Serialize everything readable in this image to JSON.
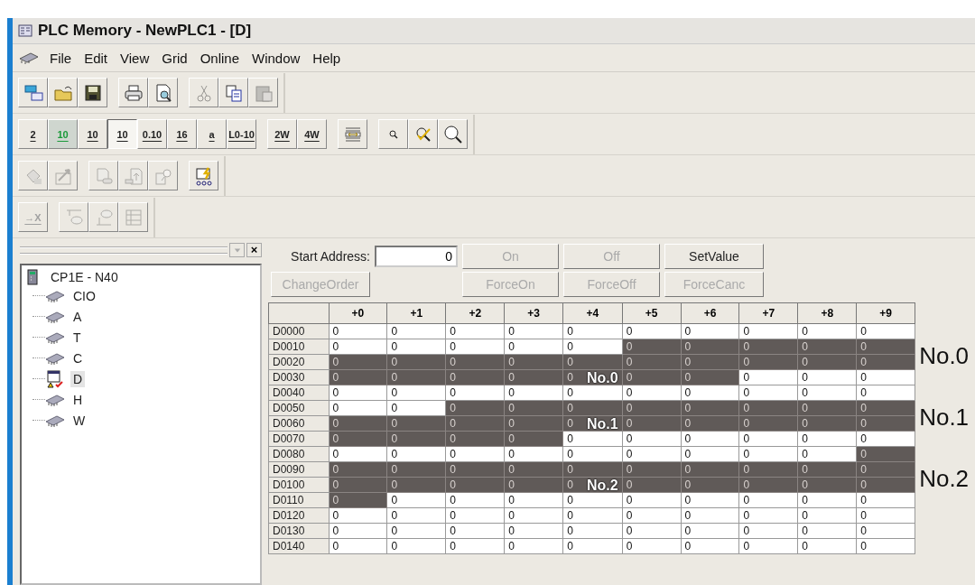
{
  "window": {
    "title": "PLC Memory - NewPLC1 - [D]"
  },
  "menu": [
    "File",
    "Edit",
    "View",
    "Grid",
    "Online",
    "Window",
    "Help"
  ],
  "toolbars": [
    [
      [
        {
          "kind": "windows",
          "disabled": false
        },
        {
          "kind": "folder",
          "disabled": false
        },
        {
          "kind": "floppy",
          "disabled": false
        }
      ],
      [
        {
          "kind": "printer",
          "disabled": false
        },
        {
          "kind": "preview",
          "disabled": false
        }
      ],
      [
        {
          "kind": "scissors",
          "disabled": true
        },
        {
          "kind": "copy",
          "disabled": false
        },
        {
          "kind": "clipboard",
          "disabled": true
        }
      ]
    ],
    [
      [
        {
          "kind": "text",
          "label": "2",
          "selected": false
        },
        {
          "kind": "display",
          "label": "10",
          "selected": false
        },
        {
          "kind": "text",
          "label": "10",
          "selected": false
        },
        {
          "kind": "text",
          "label": "10",
          "selected": true
        },
        {
          "kind": "text",
          "label": "0.10",
          "selected": false
        },
        {
          "kind": "text",
          "label": "16",
          "selected": false
        },
        {
          "kind": "text",
          "label": "a",
          "selected": false
        },
        {
          "kind": "text",
          "label": "L0-10",
          "selected": false
        }
      ],
      [
        {
          "kind": "text",
          "label": "2W",
          "selected": false
        },
        {
          "kind": "text",
          "label": "4W",
          "selected": false
        }
      ],
      [
        {
          "kind": "width",
          "disabled": false
        }
      ],
      [
        {
          "kind": "zoom-small",
          "disabled": false
        },
        {
          "kind": "zoom-check",
          "disabled": false
        },
        {
          "kind": "zoom-large",
          "disabled": false
        }
      ]
    ],
    [
      [
        {
          "kind": "paint",
          "disabled": true
        },
        {
          "kind": "arrow-box",
          "disabled": true
        }
      ],
      [
        {
          "kind": "doc",
          "disabled": true
        },
        {
          "kind": "doc-up",
          "disabled": true
        },
        {
          "kind": "doc-search",
          "disabled": true
        }
      ],
      [
        {
          "kind": "monitor",
          "disabled": false
        }
      ]
    ],
    [
      [
        {
          "kind": "text",
          "label": "→X",
          "disabled": true
        }
      ],
      [
        {
          "kind": "comment-up",
          "disabled": true
        },
        {
          "kind": "comment-down",
          "disabled": true
        },
        {
          "kind": "grid-box",
          "disabled": true
        }
      ]
    ]
  ],
  "pane": {
    "close": "×"
  },
  "tree": {
    "label": "CP1E - N40",
    "children": [
      {
        "label": "CIO",
        "selected": false
      },
      {
        "label": "A",
        "selected": false
      },
      {
        "label": "T",
        "selected": false
      },
      {
        "label": "C",
        "selected": false
      },
      {
        "label": "D",
        "selected": true
      },
      {
        "label": "H",
        "selected": false
      },
      {
        "label": "W",
        "selected": false
      }
    ]
  },
  "controls": {
    "start_address_label": "Start Address:",
    "start_address": "0",
    "row1": [
      {
        "label": "On",
        "disabled": true
      },
      {
        "label": "Off",
        "disabled": true
      },
      {
        "label": "SetValue",
        "disabled": false
      }
    ],
    "change_order": {
      "label": "ChangeOrder",
      "disabled": true
    },
    "row2": [
      {
        "label": "ForceOn",
        "disabled": true
      },
      {
        "label": "ForceOff",
        "disabled": true
      },
      {
        "label": "ForceCanc",
        "disabled": true
      }
    ]
  },
  "table": {
    "columns": [
      "+0",
      "+1",
      "+2",
      "+3",
      "+4",
      "+5",
      "+6",
      "+7",
      "+8",
      "+9"
    ],
    "rows": [
      {
        "address": "D0000",
        "cells": [
          {
            "value": "0",
            "highlighted": false
          },
          {
            "value": "0",
            "highlighted": false
          },
          {
            "value": "0",
            "highlighted": false
          },
          {
            "value": "0",
            "highlighted": false
          },
          {
            "value": "0",
            "highlighted": false
          },
          {
            "value": "0",
            "highlighted": false
          },
          {
            "value": "0",
            "highlighted": false
          },
          {
            "value": "0",
            "highlighted": false
          },
          {
            "value": "0",
            "highlighted": false
          },
          {
            "value": "0",
            "highlighted": false
          }
        ]
      },
      {
        "address": "D0010",
        "cells": [
          {
            "value": "0",
            "highlighted": false
          },
          {
            "value": "0",
            "highlighted": false
          },
          {
            "value": "0",
            "highlighted": false
          },
          {
            "value": "0",
            "highlighted": false
          },
          {
            "value": "0",
            "highlighted": false
          },
          {
            "value": "0",
            "highlighted": true
          },
          {
            "value": "0",
            "highlighted": true
          },
          {
            "value": "0",
            "highlighted": true
          },
          {
            "value": "0",
            "highlighted": true
          },
          {
            "value": "0",
            "highlighted": true
          }
        ]
      },
      {
        "address": "D0020",
        "side_label": "No.0",
        "cells": [
          {
            "value": "0",
            "highlighted": true
          },
          {
            "value": "0",
            "highlighted": true
          },
          {
            "value": "0",
            "highlighted": true
          },
          {
            "value": "0",
            "highlighted": true
          },
          {
            "value": "0",
            "highlighted": true
          },
          {
            "value": "0",
            "highlighted": true
          },
          {
            "value": "0",
            "highlighted": true
          },
          {
            "value": "0",
            "highlighted": true
          },
          {
            "value": "0",
            "highlighted": true
          },
          {
            "value": "0",
            "highlighted": true
          }
        ]
      },
      {
        "address": "D0030",
        "overlay_label": "No.0",
        "cells": [
          {
            "value": "0",
            "highlighted": true
          },
          {
            "value": "0",
            "highlighted": true
          },
          {
            "value": "0",
            "highlighted": true
          },
          {
            "value": "0",
            "highlighted": true
          },
          {
            "value": "0",
            "highlighted": true
          },
          {
            "value": "0",
            "highlighted": true
          },
          {
            "value": "0",
            "highlighted": true
          },
          {
            "value": "0",
            "highlighted": false
          },
          {
            "value": "0",
            "highlighted": false
          },
          {
            "value": "0",
            "highlighted": false
          }
        ]
      },
      {
        "address": "D0040",
        "cells": [
          {
            "value": "0",
            "highlighted": false
          },
          {
            "value": "0",
            "highlighted": false
          },
          {
            "value": "0",
            "highlighted": false
          },
          {
            "value": "0",
            "highlighted": false
          },
          {
            "value": "0",
            "highlighted": false
          },
          {
            "value": "0",
            "highlighted": false
          },
          {
            "value": "0",
            "highlighted": false
          },
          {
            "value": "0",
            "highlighted": false
          },
          {
            "value": "0",
            "highlighted": false
          },
          {
            "value": "0",
            "highlighted": false
          }
        ]
      },
      {
        "address": "D0050",
        "cells": [
          {
            "value": "0",
            "highlighted": false
          },
          {
            "value": "0",
            "highlighted": false
          },
          {
            "value": "0",
            "highlighted": true
          },
          {
            "value": "0",
            "highlighted": true
          },
          {
            "value": "0",
            "highlighted": true
          },
          {
            "value": "0",
            "highlighted": true
          },
          {
            "value": "0",
            "highlighted": true
          },
          {
            "value": "0",
            "highlighted": true
          },
          {
            "value": "0",
            "highlighted": true
          },
          {
            "value": "0",
            "highlighted": true
          }
        ]
      },
      {
        "address": "D0060",
        "side_label": "No.1",
        "overlay_label": "No.1",
        "cells": [
          {
            "value": "0",
            "highlighted": true
          },
          {
            "value": "0",
            "highlighted": true
          },
          {
            "value": "0",
            "highlighted": true
          },
          {
            "value": "0",
            "highlighted": true
          },
          {
            "value": "0",
            "highlighted": true
          },
          {
            "value": "0",
            "highlighted": true
          },
          {
            "value": "0",
            "highlighted": true
          },
          {
            "value": "0",
            "highlighted": true
          },
          {
            "value": "0",
            "highlighted": true
          },
          {
            "value": "0",
            "highlighted": true
          }
        ]
      },
      {
        "address": "D0070",
        "cells": [
          {
            "value": "0",
            "highlighted": true
          },
          {
            "value": "0",
            "highlighted": true
          },
          {
            "value": "0",
            "highlighted": true
          },
          {
            "value": "0",
            "highlighted": true
          },
          {
            "value": "0",
            "highlighted": false
          },
          {
            "value": "0",
            "highlighted": false
          },
          {
            "value": "0",
            "highlighted": false
          },
          {
            "value": "0",
            "highlighted": false
          },
          {
            "value": "0",
            "highlighted": false
          },
          {
            "value": "0",
            "highlighted": false
          }
        ]
      },
      {
        "address": "D0080",
        "cells": [
          {
            "value": "0",
            "highlighted": false
          },
          {
            "value": "0",
            "highlighted": false
          },
          {
            "value": "0",
            "highlighted": false
          },
          {
            "value": "0",
            "highlighted": false
          },
          {
            "value": "0",
            "highlighted": false
          },
          {
            "value": "0",
            "highlighted": false
          },
          {
            "value": "0",
            "highlighted": false
          },
          {
            "value": "0",
            "highlighted": false
          },
          {
            "value": "0",
            "highlighted": false
          },
          {
            "value": "0",
            "highlighted": true
          }
        ]
      },
      {
        "address": "D0090",
        "cells": [
          {
            "value": "0",
            "highlighted": true
          },
          {
            "value": "0",
            "highlighted": true
          },
          {
            "value": "0",
            "highlighted": true
          },
          {
            "value": "0",
            "highlighted": true
          },
          {
            "value": "0",
            "highlighted": true
          },
          {
            "value": "0",
            "highlighted": true
          },
          {
            "value": "0",
            "highlighted": true
          },
          {
            "value": "0",
            "highlighted": true
          },
          {
            "value": "0",
            "highlighted": true
          },
          {
            "value": "0",
            "highlighted": true
          }
        ]
      },
      {
        "address": "D0100",
        "side_label": "No.2",
        "overlay_label": "No.2",
        "cells": [
          {
            "value": "0",
            "highlighted": true
          },
          {
            "value": "0",
            "highlighted": true
          },
          {
            "value": "0",
            "highlighted": true
          },
          {
            "value": "0",
            "highlighted": true
          },
          {
            "value": "0",
            "highlighted": true
          },
          {
            "value": "0",
            "highlighted": true
          },
          {
            "value": "0",
            "highlighted": true
          },
          {
            "value": "0",
            "highlighted": true
          },
          {
            "value": "0",
            "highlighted": true
          },
          {
            "value": "0",
            "highlighted": true
          }
        ]
      },
      {
        "address": "D0110",
        "cells": [
          {
            "value": "0",
            "highlighted": true
          },
          {
            "value": "0",
            "highlighted": false
          },
          {
            "value": "0",
            "highlighted": false
          },
          {
            "value": "0",
            "highlighted": false
          },
          {
            "value": "0",
            "highlighted": false
          },
          {
            "value": "0",
            "highlighted": false
          },
          {
            "value": "0",
            "highlighted": false
          },
          {
            "value": "0",
            "highlighted": false
          },
          {
            "value": "0",
            "highlighted": false
          },
          {
            "value": "0",
            "highlighted": false
          }
        ]
      },
      {
        "address": "D0120",
        "cells": [
          {
            "value": "0",
            "highlighted": false
          },
          {
            "value": "0",
            "highlighted": false
          },
          {
            "value": "0",
            "highlighted": false
          },
          {
            "value": "0",
            "highlighted": false
          },
          {
            "value": "0",
            "highlighted": false
          },
          {
            "value": "0",
            "highlighted": false
          },
          {
            "value": "0",
            "highlighted": false
          },
          {
            "value": "0",
            "highlighted": false
          },
          {
            "value": "0",
            "highlighted": false
          },
          {
            "value": "0",
            "highlighted": false
          }
        ]
      },
      {
        "address": "D0130",
        "cells": [
          {
            "value": "0",
            "highlighted": false
          },
          {
            "value": "0",
            "highlighted": false
          },
          {
            "value": "0",
            "highlighted": false
          },
          {
            "value": "0",
            "highlighted": false
          },
          {
            "value": "0",
            "highlighted": false
          },
          {
            "value": "0",
            "highlighted": false
          },
          {
            "value": "0",
            "highlighted": false
          },
          {
            "value": "0",
            "highlighted": false
          },
          {
            "value": "0",
            "highlighted": false
          },
          {
            "value": "0",
            "highlighted": false
          }
        ]
      },
      {
        "address": "D0140",
        "cells": [
          {
            "value": "0",
            "highlighted": false
          },
          {
            "value": "0",
            "highlighted": false
          },
          {
            "value": "0",
            "highlighted": false
          },
          {
            "value": "0",
            "highlighted": false
          },
          {
            "value": "0",
            "highlighted": false
          },
          {
            "value": "0",
            "highlighted": false
          },
          {
            "value": "0",
            "highlighted": false
          },
          {
            "value": "0",
            "highlighted": false
          },
          {
            "value": "0",
            "highlighted": false
          },
          {
            "value": "0",
            "highlighted": false
          }
        ]
      }
    ]
  }
}
